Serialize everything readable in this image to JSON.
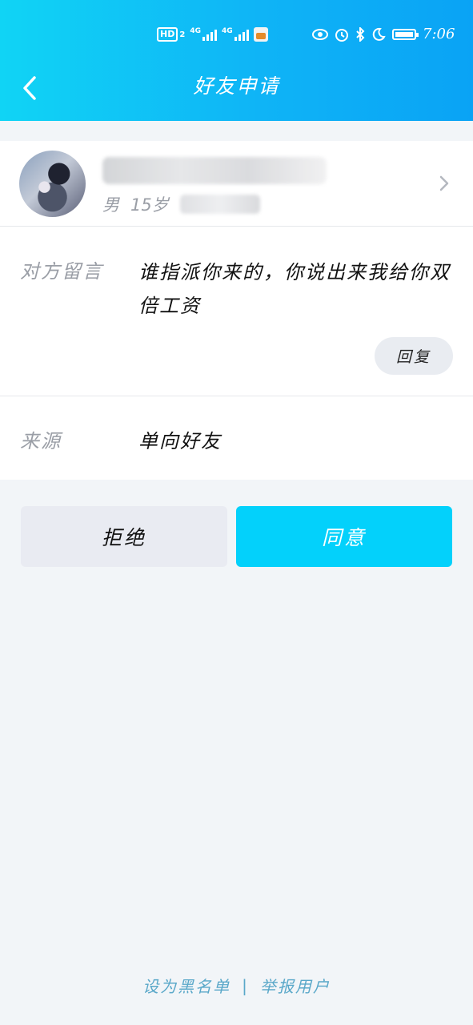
{
  "status_bar": {
    "hd_label": "HD",
    "hd_sub": "2",
    "signal1_label": "4G",
    "signal2_label": "4G",
    "time": "7:06"
  },
  "header": {
    "title": "好友申请"
  },
  "profile": {
    "gender": "男",
    "age": "15岁"
  },
  "message": {
    "label": "对方留言",
    "text": "谁指派你来的，你说出来我给你双倍工资",
    "reply_label": "回复"
  },
  "source": {
    "label": "来源",
    "value": "单向好友"
  },
  "actions": {
    "reject_label": "拒绝",
    "accept_label": "同意"
  },
  "footer": {
    "blacklist_label": "设为黑名单",
    "separator": "|",
    "report_label": "举报用户"
  },
  "colors": {
    "header_gradient_start": "#10d4f5",
    "header_gradient_end": "#0aa3f5",
    "accept_button": "#03d1fb",
    "reject_button": "#e9ebf2",
    "footer_link": "#5aa8c9"
  }
}
